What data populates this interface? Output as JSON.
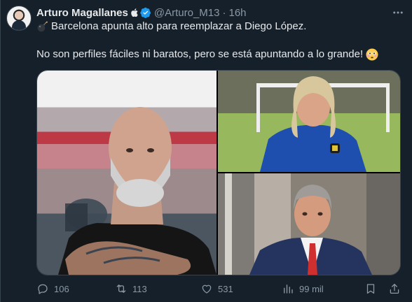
{
  "tweet": {
    "author_name": "Arturo Magallanes",
    "handle": "@Arturo_M13",
    "separator": "·",
    "time": "16h",
    "text_line1": "Barcelona apunta alto para reemplazar a Diego López.",
    "text_line2": "No son perfiles fáciles ni baratos, pero se está apuntando a lo grande!"
  },
  "icons": {
    "author_badge": "apple-icon",
    "verified": "verified-badge-icon",
    "more": "more-options-icon",
    "emoji_start": "bomb-emoji",
    "emoji_end": "flushed-face-emoji"
  },
  "media": {
    "count": 3,
    "images": [
      {
        "subject": "bald bearded man in black t-shirt with tattooed arms crossed, stadium crowd"
      },
      {
        "subject": "long-haired blond man in blue training kit on football pitch"
      },
      {
        "subject": "gray-haired man in suit with red tie"
      }
    ]
  },
  "actions": {
    "replies": "106",
    "retweets": "113",
    "likes": "531",
    "views": "99 mil"
  },
  "colors": {
    "background": "#15202b",
    "primary_text": "#e7e9ea",
    "secondary_text": "#8b98a5",
    "verified": "#1d9bf0",
    "border": "#38444d"
  }
}
